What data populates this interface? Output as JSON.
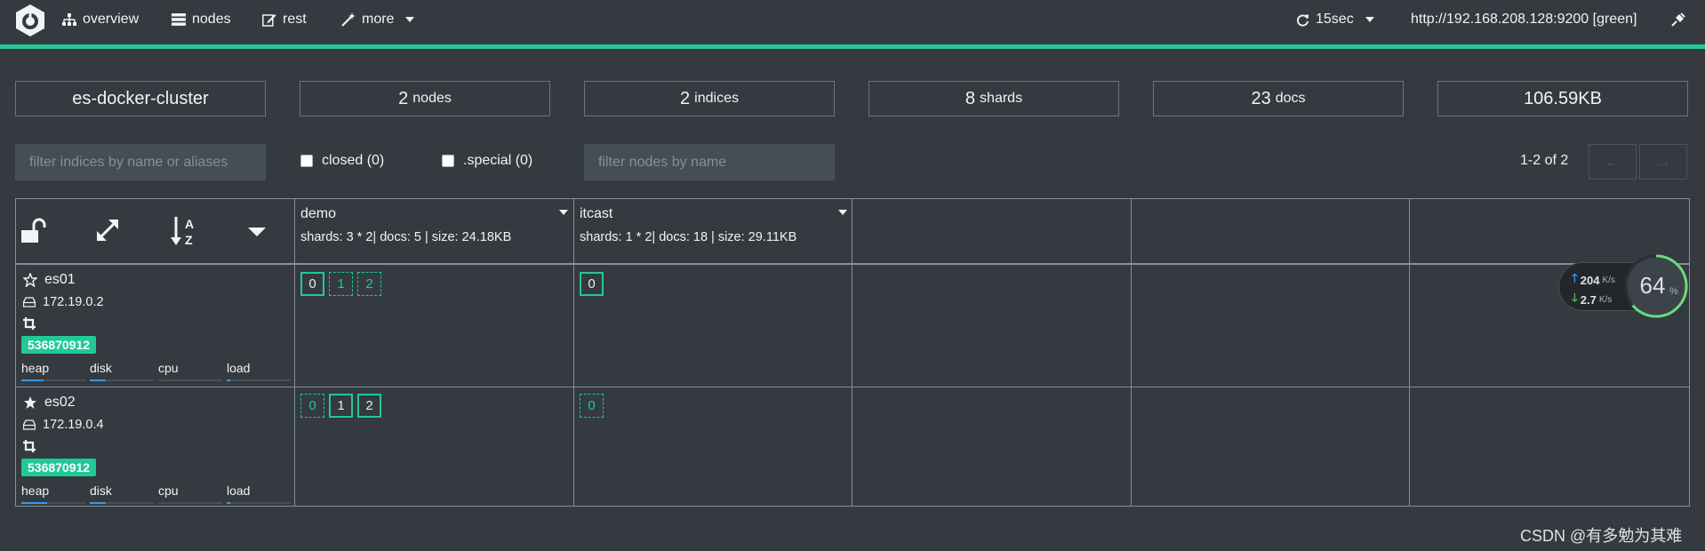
{
  "nav": {
    "overview": "overview",
    "nodes": "nodes",
    "rest": "rest",
    "more": "more",
    "refresh": "15sec",
    "cluster_url": "http://192.168.208.128:9200 [green]"
  },
  "stats": {
    "cluster_name": "es-docker-cluster",
    "nodes_count": "2",
    "nodes_label": "nodes",
    "indices_count": "2",
    "indices_label": "indices",
    "shards_count": "8",
    "shards_label": "shards",
    "docs_count": "23",
    "docs_label": "docs",
    "size": "106.59KB"
  },
  "filters": {
    "indices_placeholder": "filter indices by name or aliases",
    "closed_label": "closed (0)",
    "special_label": ".special (0)",
    "nodes_placeholder": "filter nodes by name",
    "pager_text": "1-2 of 2",
    "prev": "←",
    "next": "→"
  },
  "indices": [
    {
      "name": "demo",
      "info": "shards: 3 * 2| docs: 5 | size: 24.18KB"
    },
    {
      "name": "itcast",
      "info": "shards: 1 * 2| docs: 18 | size: 29.11KB"
    }
  ],
  "nodes": [
    {
      "name": "es01",
      "ip": "172.19.0.2",
      "badge": "536870912",
      "master": false,
      "metrics": [
        "heap",
        "disk",
        "cpu",
        "load"
      ],
      "metric_levels": [
        0.35,
        0.25,
        0.0,
        0.05
      ]
    },
    {
      "name": "es02",
      "ip": "172.19.0.4",
      "badge": "536870912",
      "master": true,
      "metrics": [
        "heap",
        "disk",
        "cpu",
        "load"
      ],
      "metric_levels": [
        0.4,
        0.25,
        0.0,
        0.05
      ]
    }
  ],
  "shards": {
    "es01_demo": [
      "0",
      "1",
      "2"
    ],
    "es01_itcast": [
      "0"
    ],
    "es02_demo": [
      "0",
      "1",
      "2"
    ],
    "es02_itcast": [
      "0"
    ]
  },
  "speed": {
    "up": "204",
    "up_unit": "K/s",
    "down": "2.7",
    "down_unit": "K/s",
    "percent": "64",
    "percent_unit": "%"
  },
  "watermark": "CSDN @有多勉为其难",
  "colors": {
    "accent": "#20c997",
    "background": "#343a40",
    "border": "#868e96",
    "bar": "#339af0"
  }
}
